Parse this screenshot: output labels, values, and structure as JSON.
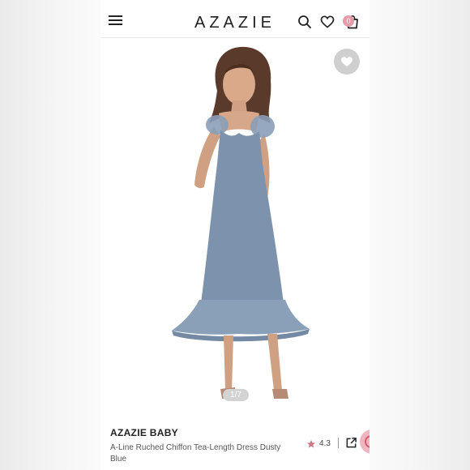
{
  "app": {
    "logo": "AZAZIE"
  },
  "header": {
    "icons": [
      "menu-icon",
      "search-icon",
      "heart-icon",
      "shopping-bag-icon"
    ],
    "cart_count": "0"
  },
  "gallery": {
    "counter": "1/7",
    "dress_color": "#7d93ad",
    "wishlist_icon": "heart-icon"
  },
  "product": {
    "brand": "AZAZIE BABY",
    "name": "A-Line Ruched Chiffon Tea-Length Dress Dusty Blue",
    "rating": "4.3",
    "rating_icon": "star-icon",
    "share_icon": "share-icon"
  },
  "colors": {
    "accent_pink": "#e69aa7",
    "text_dark": "#222222"
  }
}
